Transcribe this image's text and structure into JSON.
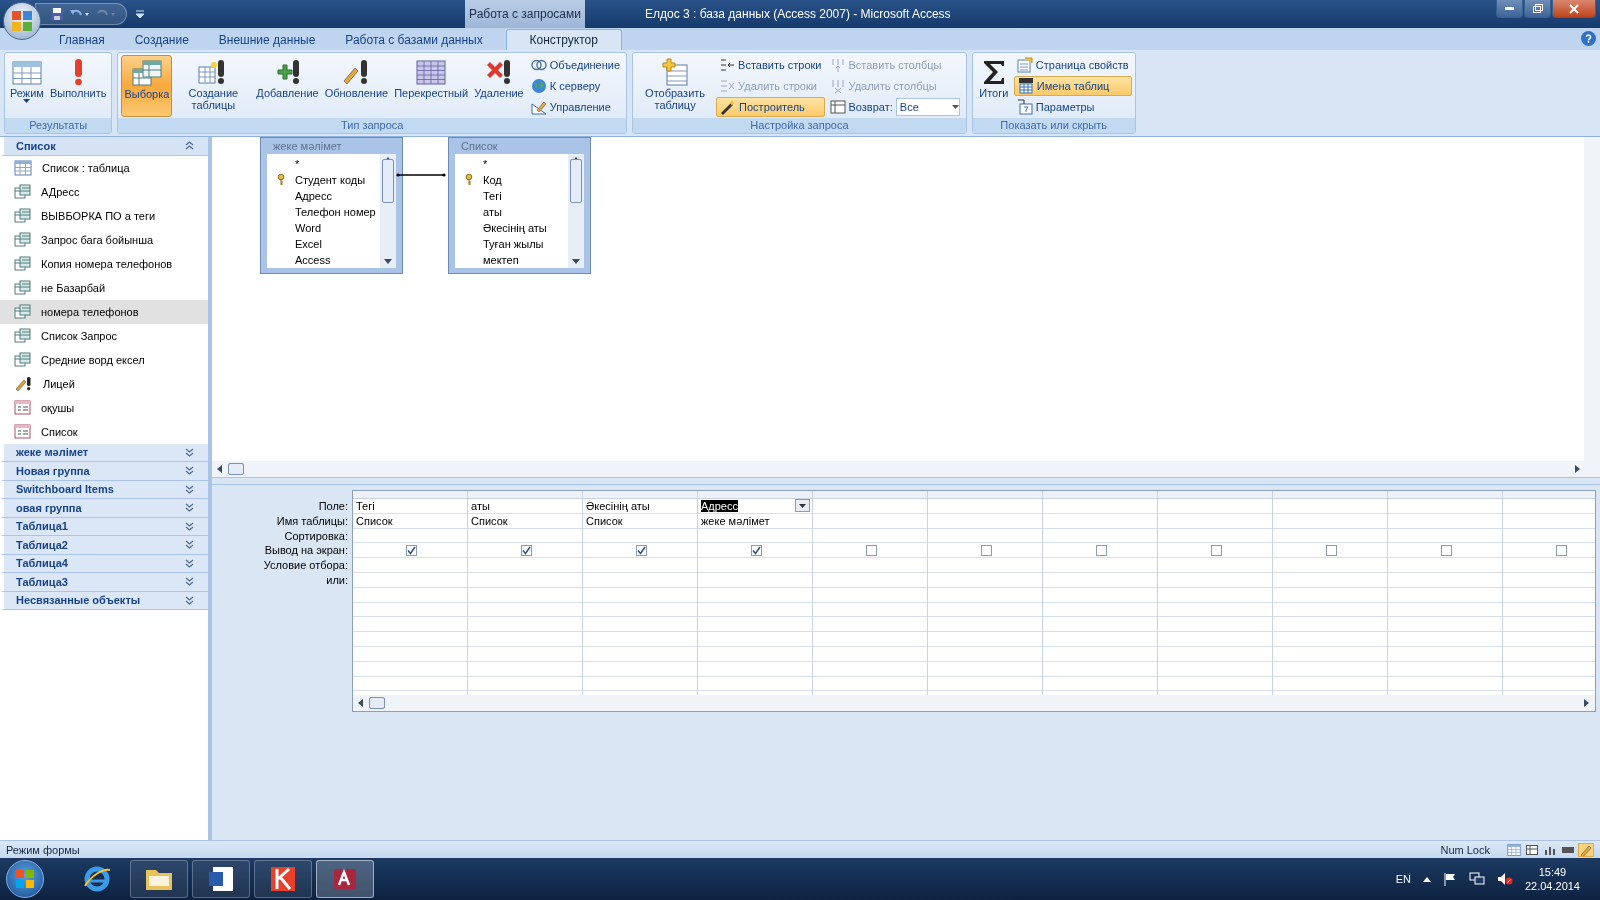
{
  "window": {
    "title": "Елдос 3 : база данных (Access 2007)  -  Microsoft Access",
    "contextual_tab": "Работа с запросами"
  },
  "ribbon_tabs": [
    {
      "label": "Главная",
      "selected": false
    },
    {
      "label": "Создание",
      "selected": false
    },
    {
      "label": "Внешние данные",
      "selected": false
    },
    {
      "label": "Работа с базами данных",
      "selected": false
    },
    {
      "label": "Конструктор",
      "selected": true
    }
  ],
  "ribbon_groups": [
    {
      "label": "Результаты",
      "columns": [
        [
          {
            "kind": "large",
            "label": "Режим",
            "menu": true,
            "selected": false
          }
        ],
        [
          {
            "kind": "large",
            "label": "Выполнить",
            "selected": false
          }
        ]
      ]
    },
    {
      "label": "Тип запроса",
      "columns": [
        [
          {
            "kind": "large",
            "label": "Выборка",
            "selected": true
          }
        ],
        [
          {
            "kind": "large",
            "label": "Создание таблицы",
            "selected": false
          }
        ],
        [
          {
            "kind": "large",
            "label": "Добавление",
            "selected": false
          }
        ],
        [
          {
            "kind": "large",
            "label": "Обновление",
            "selected": false
          }
        ],
        [
          {
            "kind": "large",
            "label": "Перекрестный",
            "selected": false
          }
        ],
        [
          {
            "kind": "large",
            "label": "Удаление",
            "selected": false
          }
        ],
        [
          {
            "kind": "small",
            "label": "Объединение",
            "selected": false,
            "disabled": false
          },
          {
            "kind": "small",
            "label": "К серверу",
            "selected": false,
            "disabled": false
          },
          {
            "kind": "small",
            "label": "Управление",
            "selected": false,
            "disabled": false
          }
        ]
      ]
    },
    {
      "label": "Настройка запроса",
      "columns": [
        [
          {
            "kind": "large",
            "label": "Отобразить таблицу",
            "selected": false
          }
        ],
        [
          {
            "kind": "small",
            "label": "Вставить строки",
            "selected": false,
            "disabled": false
          },
          {
            "kind": "small",
            "label": "Удалить строки",
            "selected": false,
            "disabled": true
          },
          {
            "kind": "small",
            "label": "Построитель",
            "selected": true,
            "disabled": false
          }
        ],
        [
          {
            "kind": "small",
            "label": "Вставить столбцы",
            "selected": false,
            "disabled": true
          },
          {
            "kind": "small",
            "label": "Удалить столбцы",
            "selected": false,
            "disabled": true
          },
          {
            "kind": "dropdown",
            "label": "Возврат:",
            "value": "Все"
          }
        ]
      ]
    },
    {
      "label": "Показать или скрыть",
      "columns": [
        [
          {
            "kind": "large",
            "label": "Итоги",
            "selected": false
          }
        ],
        [
          {
            "kind": "small",
            "label": "Страница свойств",
            "selected": false,
            "disabled": false
          },
          {
            "kind": "small",
            "label": "Имена таблиц",
            "selected": true,
            "disabled": false
          },
          {
            "kind": "small",
            "label": "Параметры",
            "selected": false,
            "disabled": false
          }
        ]
      ]
    }
  ],
  "nav_groups": [
    {
      "label": "Список",
      "expanded": true,
      "items": [
        {
          "label": "Список : таблица",
          "kind": "table",
          "selected": false
        },
        {
          "label": "АДресс",
          "kind": "query",
          "selected": false
        },
        {
          "label": "ВЫВБОРКА  ПО а теги",
          "kind": "query",
          "selected": false
        },
        {
          "label": "Запрос бага бойынша",
          "kind": "query",
          "selected": false
        },
        {
          "label": "Копия номера телефонов",
          "kind": "query",
          "selected": false
        },
        {
          "label": "не Базарбай",
          "kind": "query",
          "selected": false
        },
        {
          "label": "номера телефонов",
          "kind": "query",
          "selected": true
        },
        {
          "label": "Список Запрос",
          "kind": "query",
          "selected": false
        },
        {
          "label": "Средние ворд ексел",
          "kind": "query",
          "selected": false
        },
        {
          "label": "Лицей",
          "kind": "action",
          "selected": false
        },
        {
          "label": "оқушы",
          "kind": "form",
          "selected": false
        },
        {
          "label": "Список",
          "kind": "form",
          "selected": false
        }
      ]
    },
    {
      "label": "жеке мәлімет",
      "expanded": false
    },
    {
      "label": "Новая группа",
      "expanded": false
    },
    {
      "label": "Switchboard Items",
      "expanded": false
    },
    {
      "label": "овая группа",
      "expanded": false
    },
    {
      "label": "Таблица1",
      "expanded": false
    },
    {
      "label": "Таблица2",
      "expanded": false
    },
    {
      "label": "Таблица4",
      "expanded": false
    },
    {
      "label": "Таблица3",
      "expanded": false
    },
    {
      "label": "Несвязанные объекты",
      "expanded": false
    }
  ],
  "design_tables": [
    {
      "title": "жеке мәлімет",
      "fields": [
        {
          "label": "*",
          "primary_key": false
        },
        {
          "label": "Студент коды",
          "primary_key": true
        },
        {
          "label": "Адресс",
          "primary_key": false
        },
        {
          "label": "Телефон номер",
          "primary_key": false
        },
        {
          "label": "Word",
          "primary_key": false
        },
        {
          "label": "Excel",
          "primary_key": false
        },
        {
          "label": "Access",
          "primary_key": false
        }
      ]
    },
    {
      "title": "Список",
      "fields": [
        {
          "label": "*",
          "primary_key": false
        },
        {
          "label": "Код",
          "primary_key": true
        },
        {
          "label": "Тегі",
          "primary_key": false
        },
        {
          "label": "аты",
          "primary_key": false
        },
        {
          "label": "Әкесінің аты",
          "primary_key": false
        },
        {
          "label": "Туған жылы",
          "primary_key": false
        },
        {
          "label": "мектеп",
          "primary_key": false
        }
      ]
    }
  ],
  "grid": {
    "row_labels": [
      "Поле:",
      "Имя таблицы:",
      "Сортировка:",
      "Вывод на экран:",
      "Условие отбора:",
      "или:"
    ],
    "columns": [
      {
        "field": "Тегі",
        "table": "Список",
        "show": true,
        "active": false
      },
      {
        "field": "аты",
        "table": "Список",
        "show": true,
        "active": false
      },
      {
        "field": "Әкесінің аты",
        "table": "Список",
        "show": true,
        "active": false
      },
      {
        "field": "Адресс",
        "table": "жеке мәлімет",
        "show": true,
        "active": true
      },
      {
        "show": false,
        "active": false
      },
      {
        "show": false,
        "active": false
      },
      {
        "show": false,
        "active": false
      },
      {
        "show": false,
        "active": false
      },
      {
        "show": false,
        "active": false
      },
      {
        "show": false,
        "active": false
      },
      {
        "show": false,
        "active": false
      }
    ]
  },
  "status_bar": {
    "mode": "Режим формы",
    "indicator": "Num Lock"
  },
  "taskbar": {
    "language": "EN",
    "time": "15:49",
    "date": "22.04.2014"
  }
}
